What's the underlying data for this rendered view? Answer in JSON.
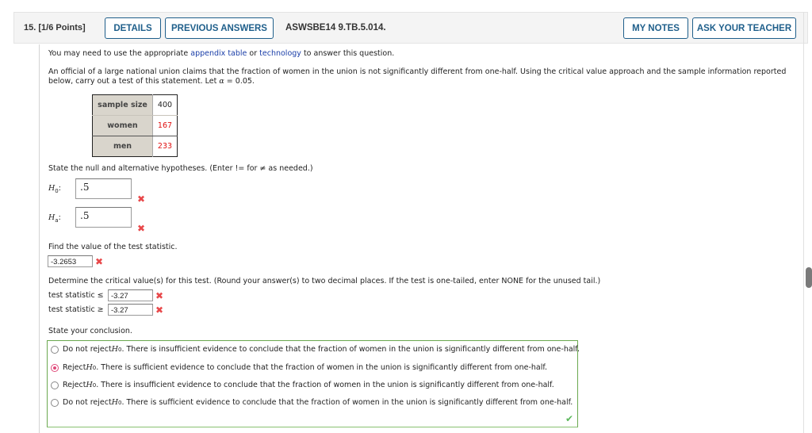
{
  "header": {
    "question_number": "15.",
    "points": "[1/6 Points]",
    "details_label": "DETAILS",
    "previous_answers_label": "PREVIOUS ANSWERS",
    "question_id": "ASWSBE14 9.TB.5.014.",
    "my_notes_label": "MY NOTES",
    "ask_teacher_label": "ASK YOUR TEACHER"
  },
  "intro": {
    "prefix": "You may need to use the appropriate ",
    "link1": "appendix table",
    "middle": " or ",
    "link2": "technology",
    "suffix": " to answer this question."
  },
  "problem": {
    "line1": "An official of a large national union claims that the fraction of women in the union is not significantly different from one-half. Using the critical value approach and the sample information reported",
    "line2_prefix": "below, carry out a test of this statement. Let ",
    "alpha_symbol": "α",
    "line2_suffix": " = 0.05."
  },
  "sample_table": [
    {
      "label": "sample size",
      "value": "400",
      "highlight": false
    },
    {
      "label": "women",
      "value": "167",
      "highlight": true
    },
    {
      "label": "men",
      "value": "233",
      "highlight": true
    }
  ],
  "hypotheses": {
    "instruction": "State the null and alternative hypotheses. (Enter != for ≠ as needed.)",
    "h0_label": "H",
    "h0_sub": "0",
    "h0_value": ".5",
    "h0_status": "incorrect",
    "ha_label": "H",
    "ha_sub": "a",
    "ha_value": ".5",
    "ha_status": "incorrect"
  },
  "test_statistic": {
    "prompt": "Find the value of the test statistic.",
    "value": "-3.2653",
    "status": "incorrect"
  },
  "critical_values": {
    "prompt": "Determine the critical value(s) for this test. (Round your answer(s) to two decimal places. If the test is one-tailed, enter NONE for the unused tail.)",
    "lower_label": "test statistic ≤",
    "lower_value": "-3.27",
    "lower_status": "incorrect",
    "upper_label": "test statistic ≥",
    "upper_value": "-3.27",
    "upper_status": "incorrect"
  },
  "conclusion": {
    "prompt": "State your conclusion.",
    "options": [
      {
        "prefix": "Do not reject ",
        "text": ". There is insufficient evidence to conclude that the fraction of women in the union is significantly different from one-half.",
        "selected": false
      },
      {
        "prefix": "Reject ",
        "text": ". There is sufficient evidence to conclude that the fraction of women in the union is significantly different from one-half.",
        "selected": true
      },
      {
        "prefix": "Reject ",
        "text": ". There is insufficient evidence to conclude that the fraction of women in the union is significantly different from one-half.",
        "selected": false
      },
      {
        "prefix": "Do not reject ",
        "text": ". There is sufficient evidence to conclude that the fraction of women in the union is significantly different from one-half.",
        "selected": false
      }
    ],
    "status": "correct"
  },
  "icons": {
    "incorrect": "✖",
    "correct": "✔"
  },
  "colors": {
    "accent": "#1f5f8b",
    "incorrect": "#e8484a",
    "correct": "#5cb85c",
    "highlight_value": "#e01010",
    "link": "#1a3ea8"
  }
}
